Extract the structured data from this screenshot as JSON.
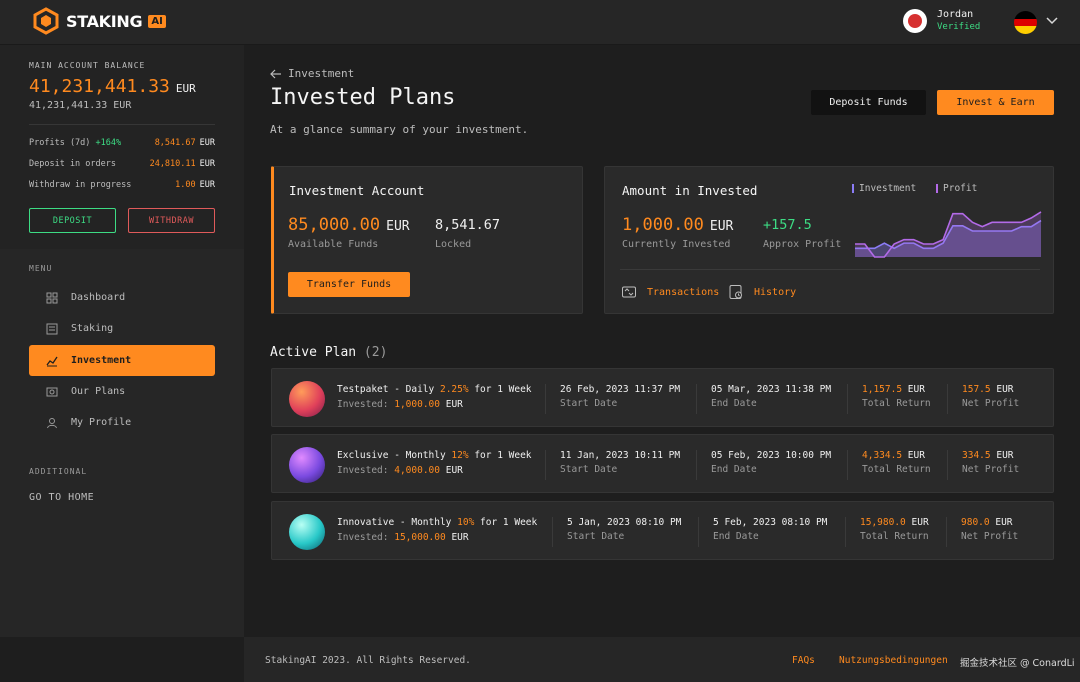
{
  "brand": {
    "name": "STAKING",
    "badge": "AI"
  },
  "user": {
    "name": "Jordan",
    "status": "Verified"
  },
  "colors": {
    "accent": "#ff8a1f",
    "positive": "#3ddc84",
    "negative": "#e05a5a",
    "investment_series": "#8b7cf6",
    "profit_series": "#b36ae8"
  },
  "sidebar": {
    "balance_label": "MAIN ACCOUNT BALANCE",
    "balance_value": "41,231,441.33",
    "balance_currency": "EUR",
    "balance_sub": "41,231,441.33 EUR",
    "rows": [
      {
        "label": "Profits (7d)",
        "pct": "+164%",
        "value": "8,541.67",
        "currency": "EUR"
      },
      {
        "label": "Deposit in orders",
        "value": "24,810.11",
        "currency": "EUR"
      },
      {
        "label": "Withdraw in progress",
        "value": "1.00",
        "currency": "EUR"
      }
    ],
    "deposit_label": "DEPOSIT",
    "withdraw_label": "WITHDRAW",
    "menu_label": "MENU",
    "menu": [
      {
        "label": "Dashboard",
        "icon": "dashboard-icon"
      },
      {
        "label": "Staking",
        "icon": "staking-icon"
      },
      {
        "label": "Investment",
        "icon": "investment-icon"
      },
      {
        "label": "Our Plans",
        "icon": "plans-icon"
      },
      {
        "label": "My Profile",
        "icon": "profile-icon"
      }
    ],
    "active_menu": "Investment",
    "additional_label": "ADDITIONAL",
    "go_home": "GO TO HOME"
  },
  "header": {
    "back_label": "Investment",
    "title": "Invested Plans",
    "subtitle": "At a glance summary of your investment.",
    "deposit_funds": "Deposit Funds",
    "invest_earn": "Invest & Earn"
  },
  "investment_account": {
    "title": "Investment Account",
    "available_value": "85,000.00",
    "available_currency": "EUR",
    "available_label": "Available Funds",
    "locked_value": "8,541.67",
    "locked_label": "Locked",
    "transfer_label": "Transfer Funds"
  },
  "amount_invested": {
    "title": "Amount in Invested",
    "invested_value": "1,000.00",
    "invested_currency": "EUR",
    "invested_label": "Currently Invested",
    "profit_value": "+157.5",
    "profit_label": "Approx Profit",
    "legend_investment": "Investment",
    "legend_profit": "Profit",
    "transactions_label": "Transactions",
    "history_label": "History"
  },
  "chart_data": {
    "type": "area",
    "x": [
      0,
      1,
      2,
      3,
      4,
      5,
      6,
      7,
      8,
      9,
      10,
      11,
      12,
      13,
      14,
      15,
      16,
      17,
      18,
      19
    ],
    "series": [
      {
        "name": "Investment",
        "values": [
          1,
          1,
          1,
          1.6,
          1,
          1.6,
          1.6,
          1,
          1,
          1.6,
          3.6,
          3.6,
          3,
          3,
          3,
          3,
          3,
          3.5,
          3.5,
          4.2
        ]
      },
      {
        "name": "Profit",
        "values": [
          1.5,
          1.5,
          0,
          0,
          1.5,
          2,
          2,
          1.5,
          1.5,
          2,
          5,
          5,
          4,
          3.5,
          4,
          4,
          4,
          4,
          4.5,
          5.2
        ]
      }
    ],
    "ylim": [
      0,
      6
    ]
  },
  "active_plan": {
    "title": "Active Plan",
    "count": "(2)",
    "plans": [
      {
        "name": "Testpaket - Daily",
        "rate": "2.25%",
        "duration": "for 1 Week",
        "invested_label": "Invested:",
        "invested_value": "1,000.00",
        "invested_currency": "EUR",
        "start": "26 Feb, 2023 11:37 PM",
        "start_label": "Start Date",
        "end": "05 Mar, 2023 11:38 PM",
        "end_label": "End Date",
        "total_return": "1,157.5",
        "total_currency": "EUR",
        "total_label": "Total Return",
        "net_profit": "157.5",
        "net_currency": "EUR",
        "net_label": "Net Profit"
      },
      {
        "name": "Exclusive - Monthly",
        "rate": "12%",
        "duration": "for 1 Week",
        "invested_label": "Invested:",
        "invested_value": "4,000.00",
        "invested_currency": "EUR",
        "start": "11 Jan, 2023 10:11 PM",
        "start_label": "Start Date",
        "end": "05 Feb, 2023 10:00 PM",
        "end_label": "End Date",
        "total_return": "4,334.5",
        "total_currency": "EUR",
        "total_label": "Total Return",
        "net_profit": "334.5",
        "net_currency": "EUR",
        "net_label": "Net Profit"
      },
      {
        "name": "Innovative - Monthly",
        "rate": "10%",
        "duration": "for 1 Week",
        "invested_label": "Invested:",
        "invested_value": "15,000.00",
        "invested_currency": "EUR",
        "start": "5 Jan, 2023 08:10 PM",
        "start_label": "Start Date",
        "end": "5 Feb, 2023 08:10 PM",
        "end_label": "End Date",
        "total_return": "15,980.0",
        "total_currency": "EUR",
        "total_label": "Total Return",
        "net_profit": "980.0",
        "net_currency": "EUR",
        "net_label": "Net Profit"
      }
    ]
  },
  "footer": {
    "copyright": "StakingAI 2023. All Rights Reserved.",
    "faqs": "FAQs",
    "terms": "Nutzungsbedingungen",
    "watermark": "掘金技术社区 @ ConardLi"
  }
}
